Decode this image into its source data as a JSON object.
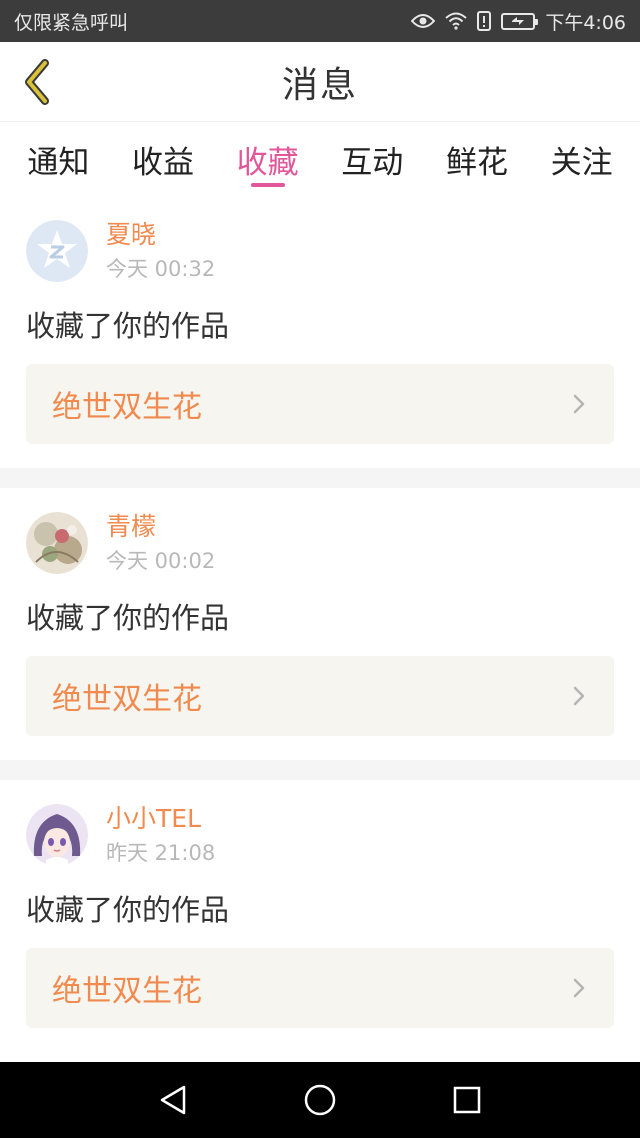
{
  "status_bar": {
    "carrier": "仅限紧急呼叫",
    "time": "下午4:06",
    "icons": [
      "eye-icon",
      "wifi-icon",
      "alert-icon",
      "battery-icon"
    ]
  },
  "header": {
    "title": "消息",
    "back_icon": "chevron-left-icon",
    "accent": "#d9c23a"
  },
  "tabs": [
    {
      "label": "通知",
      "active": false
    },
    {
      "label": "收益",
      "active": false
    },
    {
      "label": "收藏",
      "active": true
    },
    {
      "label": "互动",
      "active": false
    },
    {
      "label": "鲜花",
      "active": false
    },
    {
      "label": "关注",
      "active": false
    }
  ],
  "colors": {
    "active_tab": "#e2569a",
    "username": "#f08a4e",
    "work_title": "#f08a4e",
    "work_box_bg": "#f6f5ef"
  },
  "messages": [
    {
      "username": "夏晓",
      "time": "今天 00:32",
      "action": "收藏了你的作品",
      "work": "绝世双生花",
      "avatar": "default-avatar-icon"
    },
    {
      "username": "青檬",
      "time": "今天 00:02",
      "action": "收藏了你的作品",
      "work": "绝世双生花",
      "avatar": "photo-avatar"
    },
    {
      "username": "小小TEL",
      "time": "昨天 21:08",
      "action": "收藏了你的作品",
      "work": "绝世双生花",
      "avatar": "anime-avatar"
    }
  ],
  "nav_bar": {
    "icons": [
      "back-triangle-icon",
      "home-circle-icon",
      "recents-square-icon"
    ]
  }
}
